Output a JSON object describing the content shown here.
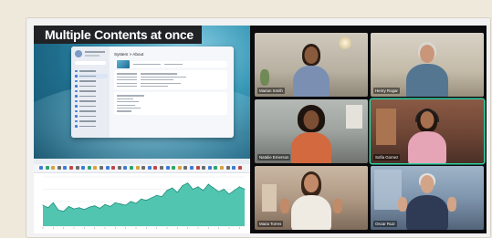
{
  "headline": "Multiple Contents at once",
  "desktop_window": {
    "title": "System > About",
    "nav_items": 12
  },
  "chart_data": {
    "type": "area",
    "title": "",
    "xlabel": "",
    "ylabel": "",
    "x": [
      0,
      1,
      2,
      3,
      4,
      5,
      6,
      7,
      8,
      9,
      10,
      11,
      12,
      13,
      14,
      15,
      16,
      17,
      18,
      19,
      20,
      21,
      22,
      23,
      24,
      25,
      26,
      27,
      28,
      29,
      30,
      31,
      32,
      33,
      34,
      35,
      36,
      37,
      38,
      39
    ],
    "values": [
      34,
      30,
      38,
      26,
      24,
      32,
      28,
      30,
      27,
      31,
      33,
      29,
      35,
      32,
      38,
      36,
      34,
      40,
      37,
      44,
      42,
      46,
      50,
      48,
      58,
      62,
      55,
      66,
      70,
      60,
      64,
      58,
      68,
      62,
      56,
      60,
      52,
      58,
      64,
      60
    ],
    "ylim": [
      0,
      80
    ],
    "grid": true,
    "color": "#3fbfa8"
  },
  "participants": [
    {
      "name": "Marian Smith",
      "active": false
    },
    {
      "name": "Henry Rogar",
      "active": false
    },
    {
      "name": "Natalie Emerson",
      "active": false
    },
    {
      "name": "Sofia Gomez",
      "active": true
    },
    {
      "name": "Maria Torres",
      "active": false
    },
    {
      "name": "Oscar Ruiz",
      "active": false
    }
  ],
  "colors": {
    "active_border": "#2fd1a4",
    "monitor": "#0c0c0e"
  }
}
